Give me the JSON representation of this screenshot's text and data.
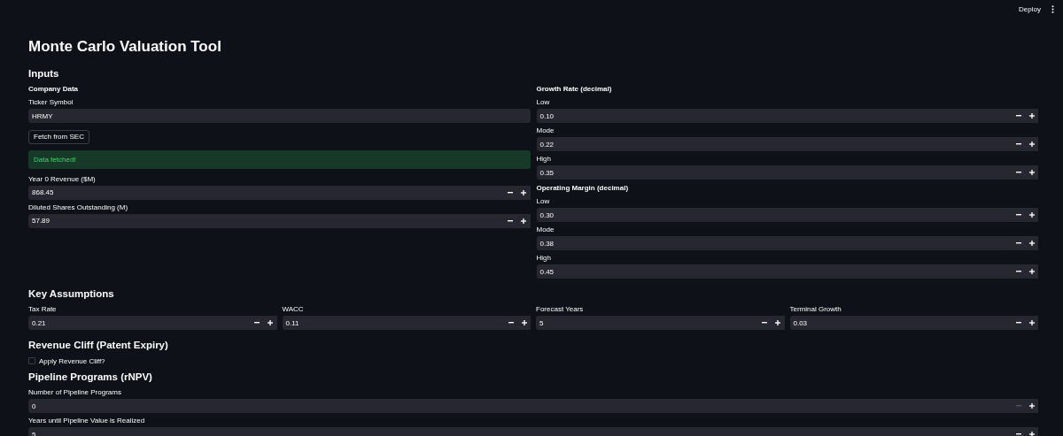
{
  "header": {
    "deploy": "Deploy"
  },
  "title": "Monte Carlo Valuation Tool",
  "inputs": {
    "heading": "Inputs",
    "company": {
      "heading": "Company Data",
      "ticker": {
        "label": "Ticker Symbol",
        "value": "HRMY"
      },
      "fetch_button": "Fetch from SEC",
      "alert": {
        "kind": "success",
        "text": "Data fetched!"
      },
      "fields": [
        {
          "label": "Year 0 Revenue ($M)",
          "value": "868.45",
          "minus_disabled": false
        },
        {
          "label": "Diluted Shares Outstanding (M)",
          "value": "57.89",
          "minus_disabled": false
        }
      ]
    },
    "growth": {
      "heading": "Growth Rate (decimal)",
      "fields": [
        {
          "label": "Low",
          "value": "0.10",
          "minus_disabled": false
        },
        {
          "label": "Mode",
          "value": "0.22",
          "minus_disabled": false
        },
        {
          "label": "High",
          "value": "0.35",
          "minus_disabled": false
        }
      ]
    },
    "margin": {
      "heading": "Operating Margin (decimal)",
      "fields": [
        {
          "label": "Low",
          "value": "0.30",
          "minus_disabled": false
        },
        {
          "label": "Mode",
          "value": "0.38",
          "minus_disabled": false
        },
        {
          "label": "High",
          "value": "0.45",
          "minus_disabled": false
        }
      ]
    }
  },
  "key_assumptions": {
    "heading": "Key Assumptions",
    "fields": [
      {
        "label": "Tax Rate",
        "value": "0.21",
        "minus_disabled": false
      },
      {
        "label": "WACC",
        "value": "0.11",
        "minus_disabled": false
      },
      {
        "label": "Forecast Years",
        "value": "5",
        "minus_disabled": false
      },
      {
        "label": "Terminal Growth",
        "value": "0.03",
        "minus_disabled": false
      }
    ]
  },
  "revenue_cliff": {
    "heading": "Revenue Cliff (Patent Expiry)",
    "checkbox": {
      "label": "Apply Revenue Cliff?",
      "checked": false
    }
  },
  "pipeline": {
    "heading": "Pipeline Programs (rNPV)",
    "fields": [
      {
        "label": "Number of Pipeline Programs",
        "value": "0",
        "minus_disabled": true
      },
      {
        "label": "Years until Pipeline Value is Realized",
        "value": "5",
        "minus_disabled": false
      }
    ]
  }
}
